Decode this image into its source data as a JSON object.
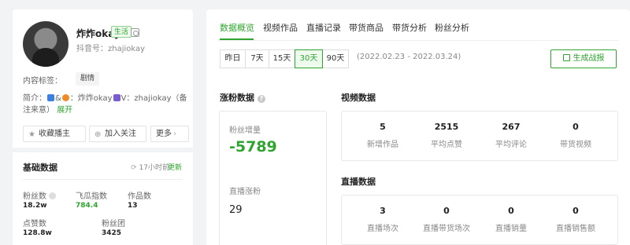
{
  "profile": {
    "nickname": "炸炸okay",
    "category_tag": "生活",
    "douyin_id": "抖音号：zhajiokay",
    "content_label": "内容标签：",
    "content_tag": "剧情",
    "bio_prefix": "简介：",
    "bio_mid": "&",
    "bio_name": "：炸炸okay",
    "bio_contact": "V：zhajiokay（备注来意）",
    "expand": "展开",
    "buttons": {
      "favorite": "收藏播主",
      "follow": "加入关注",
      "more": "更多"
    }
  },
  "basic": {
    "title": "基础数据",
    "updated": "17小时前",
    "update_link": "更新",
    "stats": [
      {
        "label": "粉丝数",
        "value": "18.2w"
      },
      {
        "label": "飞瓜指数",
        "value": "784.4"
      },
      {
        "label": "作品数",
        "value": "13"
      },
      {
        "label": "点赞数",
        "value": "128.8w"
      },
      {
        "label": "粉丝团",
        "value": "3425"
      }
    ]
  },
  "tabs": [
    "数据概览",
    "视频作品",
    "直播记录",
    "带货商品",
    "带货分析",
    "粉丝分析"
  ],
  "active_tab": 0,
  "ranges": [
    "昨日",
    "7天",
    "15天",
    "30天",
    "90天"
  ],
  "active_range": 3,
  "date_span": "(2022.02.23 - 2022.03.24)",
  "generate_report": "生成战报",
  "fans_growth": {
    "title": "涨粉数据",
    "growth_label": "粉丝增量",
    "growth_value": "-5789",
    "live_label": "直播涨粉",
    "live_value": "29"
  },
  "video_data": {
    "title": "视频数据",
    "metrics": [
      {
        "value": "5",
        "label": "新增作品"
      },
      {
        "value": "2515",
        "label": "平均点赞"
      },
      {
        "value": "267",
        "label": "平均评论"
      },
      {
        "value": "0",
        "label": "带货视频"
      }
    ]
  },
  "live_data": {
    "title": "直播数据",
    "metrics": [
      {
        "value": "3",
        "label": "直播场次"
      },
      {
        "value": "0",
        "label": "直播带货场次"
      },
      {
        "value": "0",
        "label": "直播销量"
      },
      {
        "value": "0",
        "label": "直播销售额"
      }
    ]
  },
  "colors": {
    "accent": "#2fa52f",
    "background": "#f2f3f5"
  }
}
